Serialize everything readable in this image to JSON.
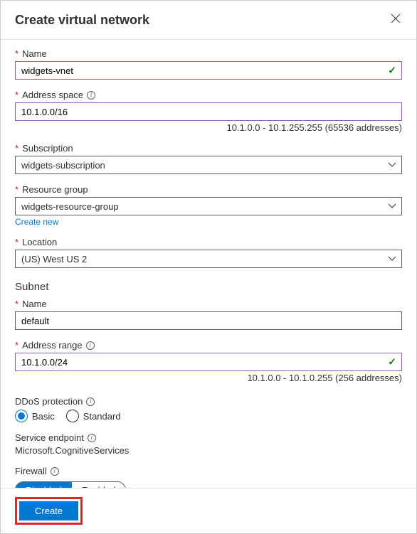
{
  "header": {
    "title": "Create virtual network"
  },
  "fields": {
    "name": {
      "label": "Name",
      "value": "widgets-vnet"
    },
    "addressSpace": {
      "label": "Address space",
      "value": "10.1.0.0/16",
      "hint": "10.1.0.0 - 10.1.255.255 (65536 addresses)"
    },
    "subscription": {
      "label": "Subscription",
      "value": "widgets-subscription"
    },
    "resourceGroup": {
      "label": "Resource group",
      "value": "widgets-resource-group",
      "createNew": "Create new"
    },
    "location": {
      "label": "Location",
      "value": "(US) West US 2"
    }
  },
  "subnet": {
    "heading": "Subnet",
    "name": {
      "label": "Name",
      "value": "default"
    },
    "range": {
      "label": "Address range",
      "value": "10.1.0.0/24",
      "hint": "10.1.0.0 - 10.1.0.255 (256 addresses)"
    }
  },
  "ddos": {
    "label": "DDoS protection",
    "options": {
      "basic": "Basic",
      "standard": "Standard"
    }
  },
  "serviceEndpoint": {
    "label": "Service endpoint",
    "value": "Microsoft.CognitiveServices"
  },
  "firewall": {
    "label": "Firewall",
    "options": {
      "disabled": "Disabled",
      "enabled": "Enabled"
    }
  },
  "footer": {
    "create": "Create"
  }
}
